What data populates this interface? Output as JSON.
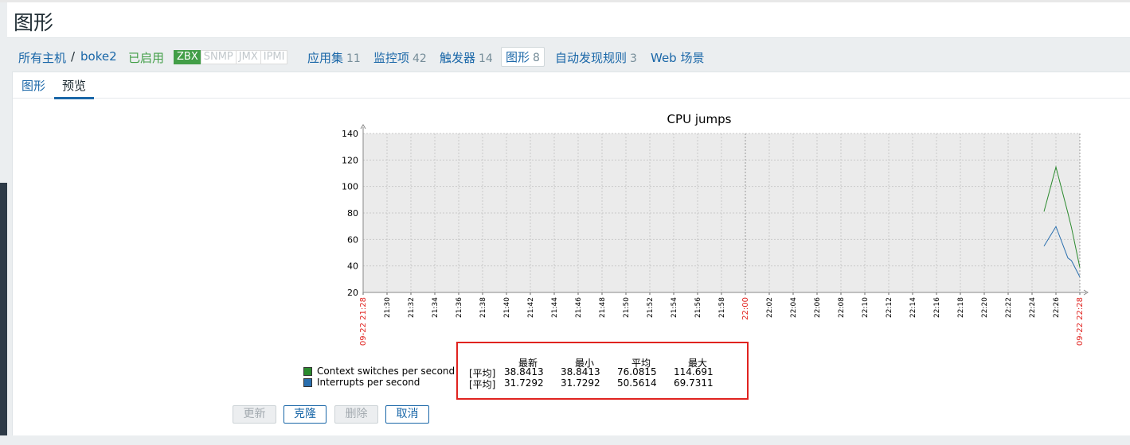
{
  "page": {
    "title": "图形"
  },
  "nav": {
    "all_hosts": "所有主机",
    "separator": "/",
    "host": "boke2",
    "status": "已启用",
    "tags": [
      "ZBX",
      "SNMP",
      "JMX",
      "IPMI"
    ],
    "items": [
      {
        "label": "应用集",
        "count": "11"
      },
      {
        "label": "监控项",
        "count": "42"
      },
      {
        "label": "触发器",
        "count": "14"
      },
      {
        "label": "图形",
        "count": "8"
      },
      {
        "label": "自动发现规则",
        "count": "3"
      },
      {
        "label": "Web 场景",
        "count": ""
      }
    ]
  },
  "subtabs": {
    "graph": "图形",
    "preview": "预览"
  },
  "chart_data": {
    "type": "line",
    "title": "CPU jumps",
    "ylim": [
      20,
      140
    ],
    "yticks": [
      "20",
      "40",
      "60",
      "80",
      "100",
      "120",
      "140"
    ],
    "xticks": [
      "09-22 21:28",
      "21:30",
      "21:32",
      "21:34",
      "21:36",
      "21:38",
      "21:40",
      "21:42",
      "21:44",
      "21:46",
      "21:48",
      "21:50",
      "21:52",
      "21:54",
      "21:56",
      "21:58",
      "22:00",
      "22:02",
      "22:04",
      "22:06",
      "22:08",
      "22:10",
      "22:12",
      "22:14",
      "22:16",
      "22:18",
      "22:20",
      "22:22",
      "22:24",
      "22:26",
      "09-22 22:28"
    ],
    "red_ticks": [
      "09-22 21:28",
      "22:00",
      "09-22 22:28"
    ],
    "x_unit": "minutes",
    "series": [
      {
        "name": "Context switches per second",
        "color": "#2b8a2e",
        "x": [
          "22:25",
          "22:26",
          "22:27",
          "22:27.3",
          "22:28"
        ],
        "values": [
          81,
          114.691,
          80,
          69,
          38.8413
        ]
      },
      {
        "name": "Interrupts per second",
        "color": "#2a6fae",
        "x": [
          "22:25",
          "22:26",
          "22:27",
          "22:27.3",
          "22:28"
        ],
        "values": [
          55,
          69.7311,
          46,
          44,
          31.7292
        ]
      }
    ],
    "grid": true
  },
  "stats": {
    "headers": [
      "最新",
      "最小",
      "平均",
      "最大"
    ],
    "rows": [
      {
        "func": "[平均]",
        "values": [
          "38.8413",
          "38.8413",
          "76.0815",
          "114.691"
        ]
      },
      {
        "func": "[平均]",
        "values": [
          "31.7292",
          "31.7292",
          "50.5614",
          "69.7311"
        ]
      }
    ]
  },
  "buttons": {
    "update": "更新",
    "clone": "克隆",
    "delete": "删除",
    "cancel": "取消"
  },
  "colors": {
    "accent": "#1a67a8",
    "enabled": "#429e47",
    "highlight": "#e0231f"
  }
}
